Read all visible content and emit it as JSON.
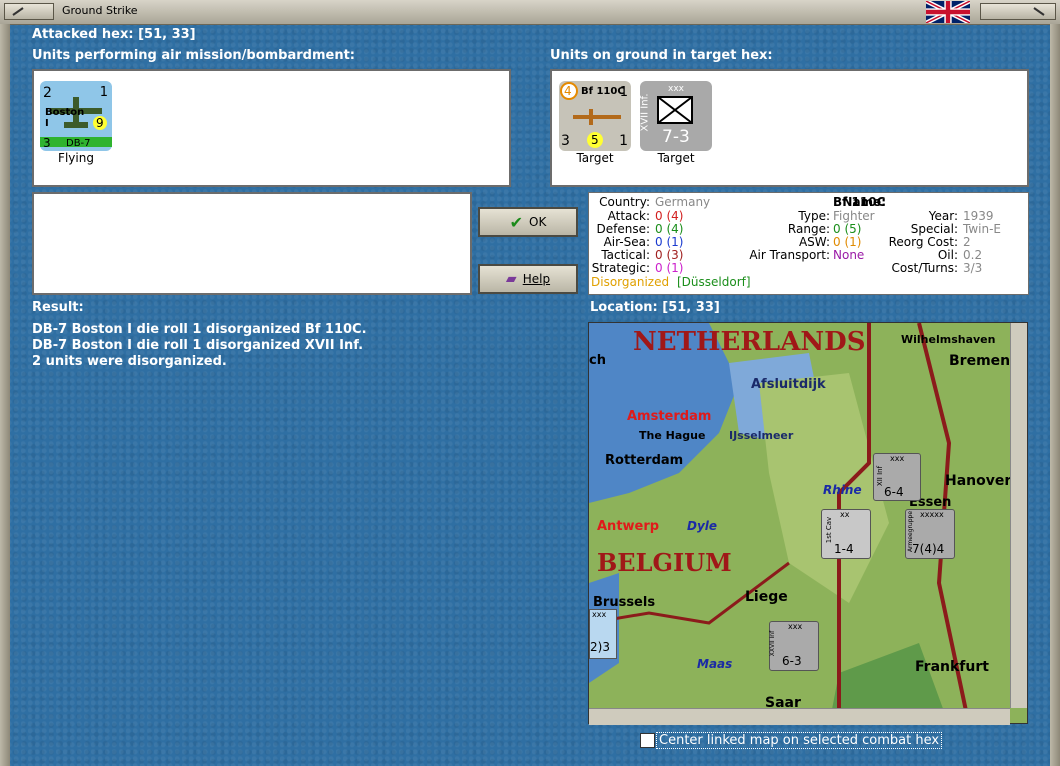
{
  "window": {
    "title": "Ground Strike"
  },
  "attacked_hex": "Attacked hex:  [51, 33]",
  "air_units_label": "Units performing air mission/bombardment:",
  "ground_units_label": "Units on ground in target hex:",
  "air_units": [
    {
      "name": "DB-7",
      "sub": "Boston I",
      "top_left": "2",
      "top_right": "1",
      "bottom_left": "3",
      "badge": "9",
      "status": "Flying"
    }
  ],
  "ground_units": [
    {
      "name": "Bf 110C",
      "top_left": "4",
      "top_right": "1",
      "bottom_left": "3",
      "badge": "5",
      "bottom_right": "1",
      "status": "Target"
    },
    {
      "name": "XVII Inf.",
      "size": "xxx",
      "strength": "7-3",
      "status": "Target"
    }
  ],
  "buttons": {
    "ok": "OK",
    "help": "Help"
  },
  "info": {
    "country_label": "Country:",
    "country": "Germany",
    "attack_label": "Attack:",
    "attack": "0 (4)",
    "defense_label": "Defense:",
    "defense": "0 (4)",
    "airsea_label": "Air-Sea:",
    "airsea": "0 (1)",
    "tactical_label": "Tactical:",
    "tactical": "0 (3)",
    "strategic_label": "Strategic:",
    "strategic": "0 (1)",
    "status": "Disorganized",
    "location": "[Düsseldorf]",
    "name_label": "Name:",
    "name": "Bf 110C",
    "type_label": "Type:",
    "type": "Fighter",
    "range_label": "Range:",
    "range": "0 (5)",
    "asw_label": "ASW:",
    "asw": "0 (1)",
    "air_transport_label": "Air Transport:",
    "air_transport": "None",
    "year_label": "Year:",
    "year": "1939",
    "special_label": "Special:",
    "special": "Twin-E",
    "reorg_label": "Reorg Cost:",
    "reorg": "2",
    "oil_label": "Oil:",
    "oil": "0.2",
    "cost_label": "Cost/Turns:",
    "cost": "3/3"
  },
  "result_label": "Result:",
  "result_lines": [
    "DB-7 Boston I die roll 1 disorganized Bf 110C.",
    "DB-7 Boston I die roll 1 disorganized XVII Inf.",
    "2 units were disorganized."
  ],
  "location_label": "Location:   [51, 33]",
  "map": {
    "netherlands": "NETHERLANDS",
    "belgium": "BELGIUM",
    "cities": [
      "Wilhelmshaven",
      "Bremen",
      "Afsluitdijk",
      "Amsterdam",
      "The Hague",
      "IJsselmeer",
      "Rotterdam",
      "Hanover",
      "Rhine",
      "Antwerp",
      "Dyle",
      "Essen",
      "Brussels",
      "Liege",
      "Maas",
      "Frankfurt",
      "Saar",
      "ch"
    ],
    "counters": [
      {
        "label": "6-4",
        "top": "xxx",
        "side": "XII Inf"
      },
      {
        "label": "1-4",
        "top": "xx",
        "side": "1st Cav"
      },
      {
        "label": "7(4)4",
        "top": "xxxxx",
        "side": "Armeegruppe"
      },
      {
        "label": "6-3",
        "top": "xxx",
        "side": "XXVII Inf"
      },
      {
        "label": "2)3",
        "top": "xxx"
      }
    ]
  },
  "center_map_label": "Center linked map on selected combat hex",
  "colors": {
    "background": "#2f6fa3",
    "accent": "#ffff00"
  }
}
